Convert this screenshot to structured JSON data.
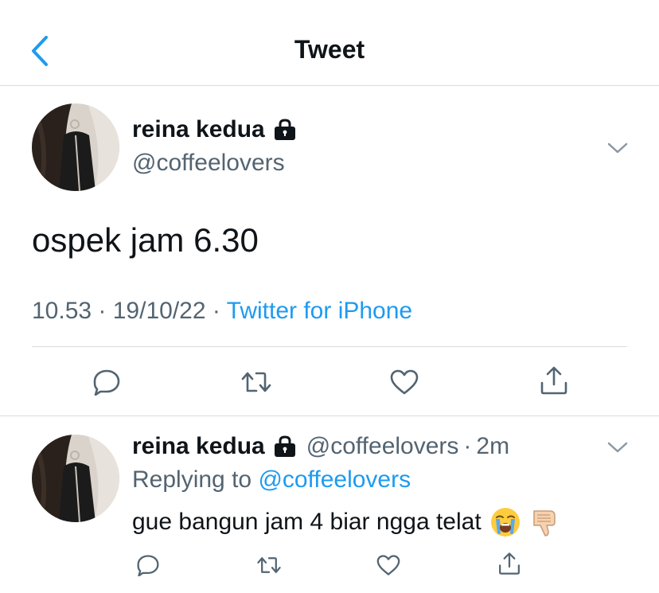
{
  "header": {
    "title": "Tweet",
    "back_icon": "chevron-left-icon"
  },
  "colors": {
    "link": "#1d9bf0",
    "text": "#0f1419",
    "muted": "#536471",
    "divider": "#dcdcdc"
  },
  "tweet": {
    "display_name": "reina kedua",
    "handle": "@coffeelovers",
    "text": "ospek jam 6.30",
    "time": "10.53",
    "date": "19/10/22",
    "separator": "·",
    "source": "Twitter for iPhone",
    "icons": [
      "lock-icon",
      "chevron-down-icon",
      "reply-icon",
      "retweet-icon",
      "like-icon",
      "share-icon"
    ]
  },
  "reply": {
    "display_name": "reina kedua",
    "handle": "@coffeelovers",
    "separator": "·",
    "time_ago": "2m",
    "replying_prefix": "Replying to",
    "replying_to": "@coffeelovers",
    "text": "gue bangun jam 4 biar ngga telat",
    "emojis": [
      "loudly-crying-face-emoji",
      "thumbs-down-emoji"
    ]
  }
}
